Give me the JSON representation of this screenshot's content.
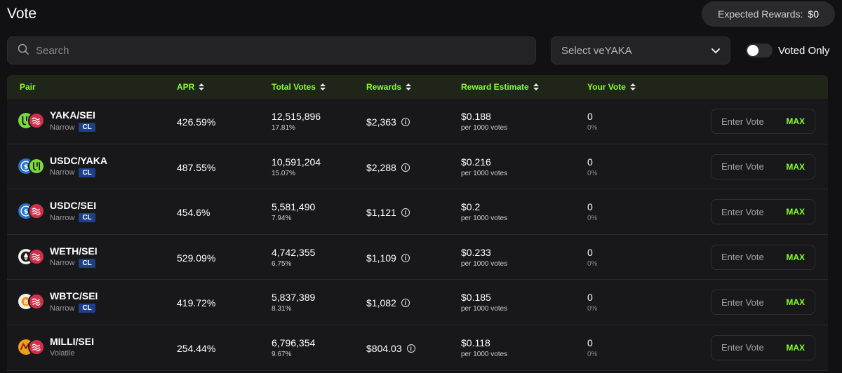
{
  "header": {
    "title": "Vote",
    "expected_rewards_label": "Expected Rewards:",
    "expected_rewards_value": "$0"
  },
  "search": {
    "placeholder": "Search",
    "icon": "search-icon"
  },
  "veyaka_select": {
    "placeholder": "Select veYAKA",
    "icon": "chevron-down-icon"
  },
  "voted_only": {
    "label": "Voted Only",
    "checked": false
  },
  "table": {
    "columns": [
      "Pair",
      "APR",
      "Total Votes",
      "Rewards",
      "Reward Estimate",
      "Your Vote"
    ],
    "input_placeholder": "Enter Vote",
    "max_label": "MAX",
    "rows": [
      {
        "pair": "YAKA/SEI",
        "type": "Narrow",
        "badge": "CL",
        "icon_a": "yaka-token-icon",
        "icon_b": "sei-token-icon",
        "apr": "426.59%",
        "total_votes": "12,515,896",
        "votes_pct": "17.81%",
        "rewards": "$2,363",
        "estimate": "$0.188",
        "estimate_sub": "per 1000 votes",
        "your_vote": "0",
        "your_vote_pct": "0%"
      },
      {
        "pair": "USDC/YAKA",
        "type": "Narrow",
        "badge": "CL",
        "icon_a": "usdc-token-icon",
        "icon_b": "yaka-token-icon",
        "apr": "487.55%",
        "total_votes": "10,591,204",
        "votes_pct": "15.07%",
        "rewards": "$2,288",
        "estimate": "$0.216",
        "estimate_sub": "per 1000 votes",
        "your_vote": "0",
        "your_vote_pct": "0%"
      },
      {
        "pair": "USDC/SEI",
        "type": "Narrow",
        "badge": "CL",
        "icon_a": "usdc-token-icon",
        "icon_b": "sei-token-icon",
        "apr": "454.6%",
        "total_votes": "5,581,490",
        "votes_pct": "7.94%",
        "rewards": "$1,121",
        "estimate": "$0.2",
        "estimate_sub": "per 1000 votes",
        "your_vote": "0",
        "your_vote_pct": "0%"
      },
      {
        "pair": "WETH/SEI",
        "type": "Narrow",
        "badge": "CL",
        "icon_a": "weth-token-icon",
        "icon_b": "sei-token-icon",
        "apr": "529.09%",
        "total_votes": "4,742,355",
        "votes_pct": "6.75%",
        "rewards": "$1,109",
        "estimate": "$0.233",
        "estimate_sub": "per 1000 votes",
        "your_vote": "0",
        "your_vote_pct": "0%"
      },
      {
        "pair": "WBTC/SEI",
        "type": "Narrow",
        "badge": "CL",
        "icon_a": "wbtc-token-icon",
        "icon_b": "sei-token-icon",
        "apr": "419.72%",
        "total_votes": "5,837,389",
        "votes_pct": "8.31%",
        "rewards": "$1,082",
        "estimate": "$0.185",
        "estimate_sub": "per 1000 votes",
        "your_vote": "0",
        "your_vote_pct": "0%"
      },
      {
        "pair": "MILLI/SEI",
        "type": "Volatile",
        "badge": "",
        "icon_a": "milli-token-icon",
        "icon_b": "sei-token-icon",
        "apr": "254.44%",
        "total_votes": "6,796,354",
        "votes_pct": "9.67%",
        "rewards": "$804.03",
        "estimate": "$0.118",
        "estimate_sub": "per 1000 votes",
        "your_vote": "0",
        "your_vote_pct": "0%"
      }
    ]
  },
  "colors": {
    "accent": "#86ff2e",
    "background": "#111113",
    "row": "#18181a",
    "header_row": "#1f2619",
    "badge": "#1d3f8c",
    "sei": "#d2304a",
    "yaka": "#7ad93c",
    "usdc": "#2775ca"
  }
}
